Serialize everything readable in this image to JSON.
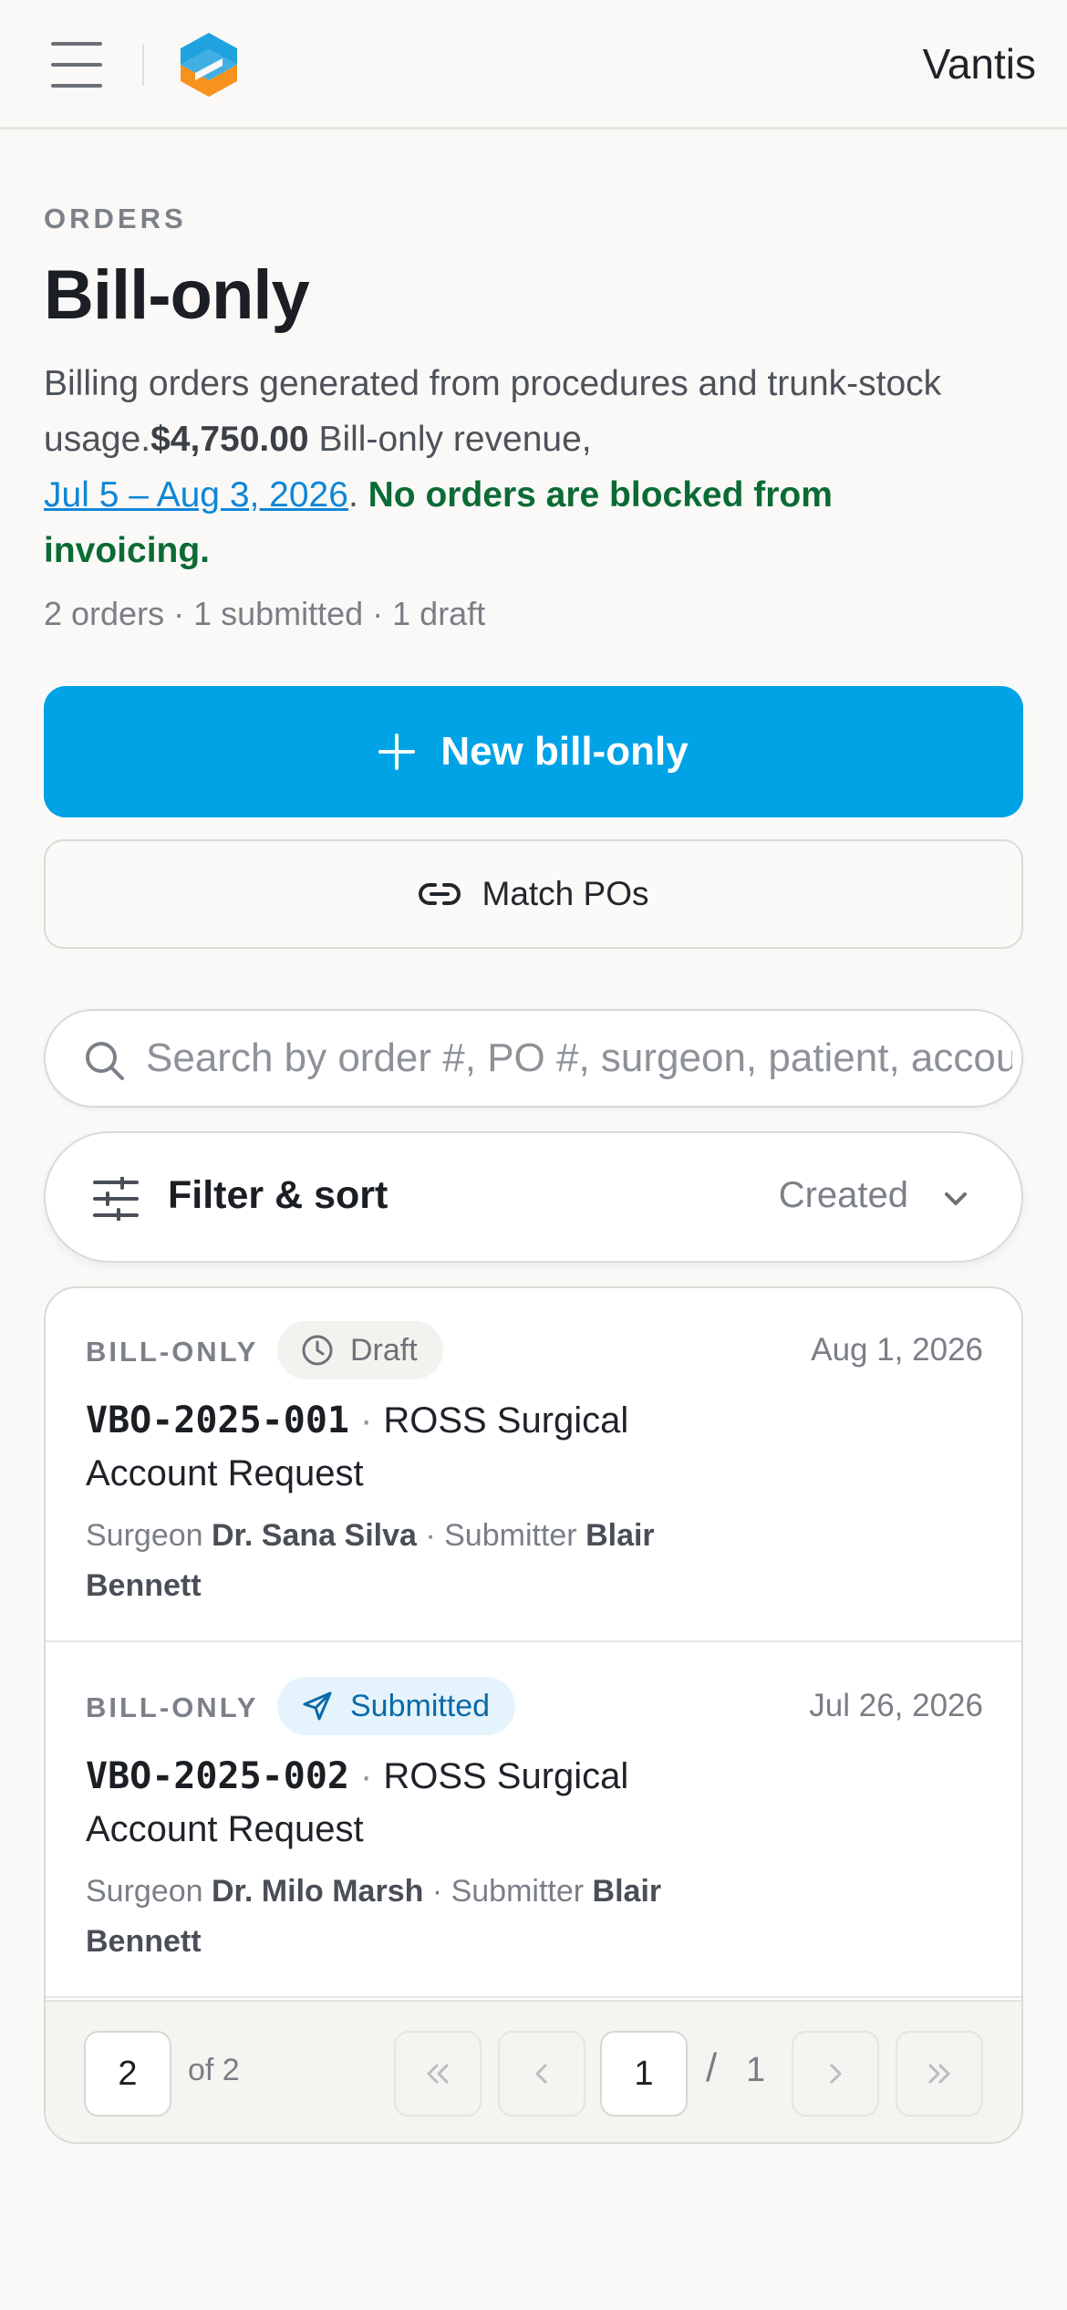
{
  "topbar": {
    "brand": "Vantis",
    "colors": {
      "logo_blue": "#1fa3e0",
      "logo_orange": "#f6921e"
    }
  },
  "header": {
    "eyebrow": "ORDERS",
    "title": "Bill-only",
    "desc_prefix": "Billing orders generated from procedures and trunk-stock usage.",
    "revenue_amount": "$4,750.00",
    "revenue_suffix": " Bill-only revenue,",
    "date_range": "Jul 5 – Aug 3, 2026",
    "date_period": ".",
    "status_note": "No orders are blocked from invoicing.",
    "counts": "2 orders · 1 submitted · 1 draft"
  },
  "actions": {
    "primary_label": "New bill-only",
    "secondary_label": "Match POs",
    "primary_color": "#00a3e6"
  },
  "search": {
    "placeholder": "Search by order #, PO #, surgeon, patient, account"
  },
  "filter": {
    "label": "Filter & sort",
    "sort_value": "Created"
  },
  "orders": [
    {
      "type": "BILL-ONLY",
      "status": "Draft",
      "status_icon": "clock-icon",
      "date": "Aug 1, 2026",
      "code": "VBO-2025-001",
      "account": "ROSS Surgical Account Request",
      "surgeon_label": "Surgeon",
      "surgeon": "Dr. Sana Silva",
      "submitter_label": "Submitter",
      "submitter": "Blair Bennett"
    },
    {
      "type": "BILL-ONLY",
      "status": "Submitted",
      "status_icon": "send-icon",
      "date": "Jul 26, 2026",
      "code": "VBO-2025-002",
      "account": "ROSS Surgical Account Request",
      "surgeon_label": "Surgeon",
      "surgeon": "Dr. Milo Marsh",
      "submitter_label": "Submitter",
      "submitter": "Blair Bennett"
    }
  ],
  "pagination": {
    "page_size": "2",
    "of_total": "of 2",
    "current_page": "1",
    "separator": "/",
    "total_pages": "1"
  }
}
